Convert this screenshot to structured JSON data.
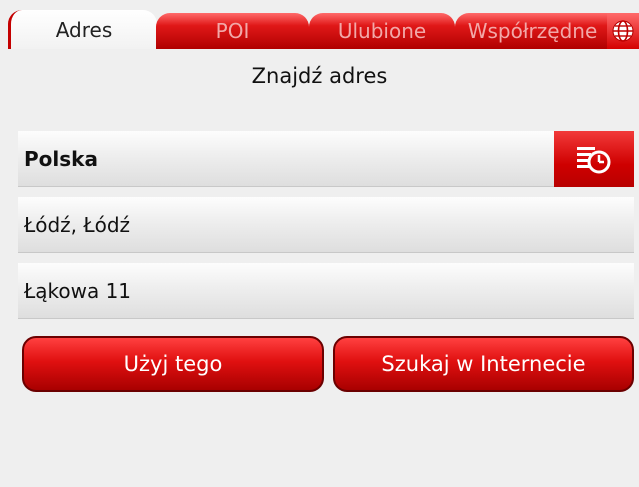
{
  "tabs": [
    {
      "label": "Adres",
      "active": true
    },
    {
      "label": "POI",
      "active": false
    },
    {
      "label": "Ulubione",
      "active": false
    },
    {
      "label": "Współrzędne",
      "active": false
    }
  ],
  "tab_extra_icon": "globe-icon",
  "page_title": "Znajdź adres",
  "form": {
    "country": "Polska",
    "city": "Łódź, Łódź",
    "street": "Łąkowa 11",
    "history_icon": "history-list-icon"
  },
  "buttons": {
    "use": "Użyj tego",
    "search_web": "Szukaj w Internecie"
  },
  "colors": {
    "accent": "#d40000",
    "background": "#efefef"
  }
}
